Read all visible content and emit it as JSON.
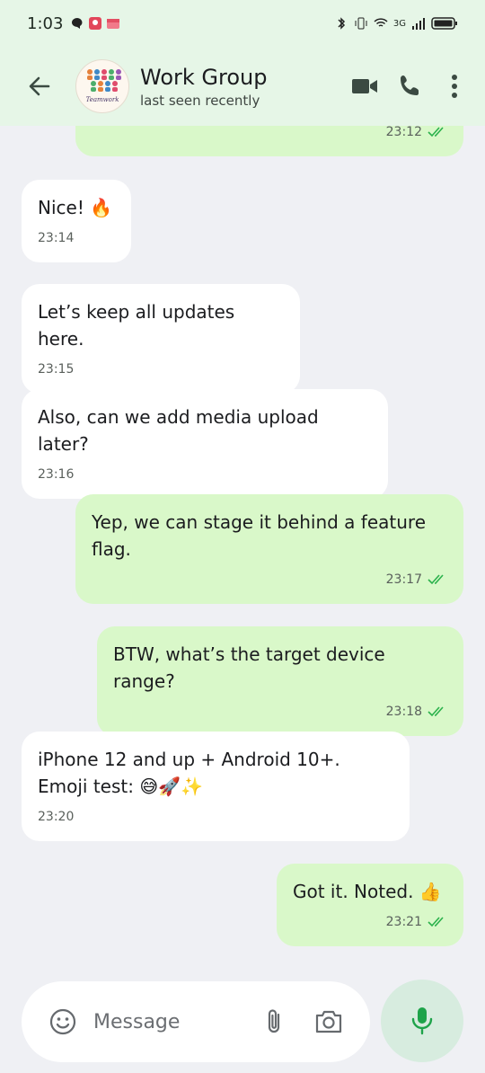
{
  "status_bar": {
    "time": "1:03",
    "network": "3G"
  },
  "header": {
    "title": "Work Group",
    "subtitle": "last seen recently",
    "avatar_text": "Teamwork"
  },
  "messages": [
    {
      "direction": "out",
      "text": "",
      "time": "23:12",
      "ticks": "double-check-icon"
    },
    {
      "direction": "in",
      "text": "Nice! 🔥",
      "time": "23:14"
    },
    {
      "direction": "in",
      "text": "Let’s keep all updates here.",
      "time": "23:15"
    },
    {
      "direction": "in",
      "text": "Also, can we add media upload later?",
      "time": "23:16"
    },
    {
      "direction": "out",
      "text": "Yep, we can stage it behind a feature flag.",
      "time": "23:17",
      "ticks": "double-check-icon"
    },
    {
      "direction": "out",
      "text": "BTW, what’s the target device range?",
      "time": "23:18",
      "ticks": "double-check-icon"
    },
    {
      "direction": "in",
      "text": "iPhone 12 and up + Android 10+. Emoji test: 😅🚀✨",
      "time": "23:20"
    },
    {
      "direction": "out",
      "text": "Got it. Noted. 👍",
      "time": "23:21",
      "ticks": "double-check-icon"
    }
  ],
  "composer": {
    "placeholder": "Message"
  },
  "colors": {
    "header_bg": "#e6f6e7",
    "chat_bg": "#eff0f4",
    "incoming_bubble": "#ffffff",
    "outgoing_bubble": "#d9f8c9",
    "tick_color": "#2bb24c",
    "mic_bg": "#d7ecdf",
    "mic_icon": "#1ea34a"
  }
}
